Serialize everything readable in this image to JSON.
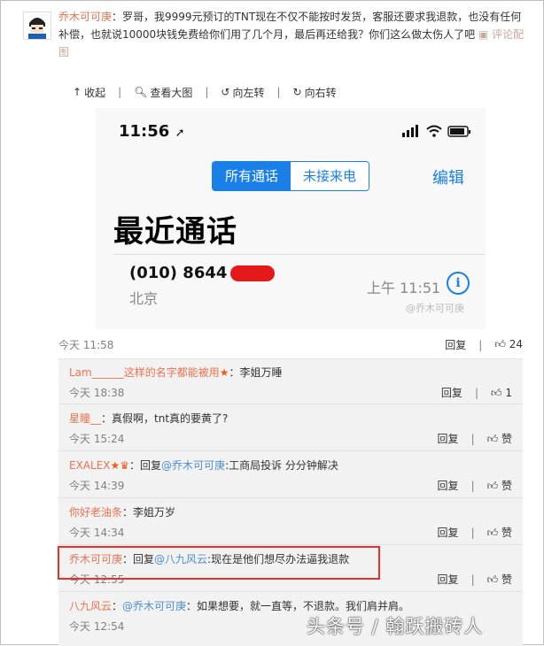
{
  "post": {
    "author": "乔木可可庚",
    "text": "：罗哥，我9999元预订的TNT现在不仅不能按时发货，客服还要求我退款，也没有任何补偿，也就说10000块钱免费给你们用了几个月，最后再还给我？你们这么做太伤人了吧",
    "action": "评论配图"
  },
  "toolbar": {
    "collapse": "收起",
    "view_large": "查看大图",
    "rotate_left": "向左转",
    "rotate_right": "向右转"
  },
  "screenshot": {
    "time": "11:56",
    "tab_all": "所有通话",
    "tab_missed": "未接来电",
    "edit": "编辑",
    "title": "最近通话",
    "number": "(010) 8644",
    "city": "北京",
    "call_time": "上午 11:51",
    "watermark": "@乔木可可庚"
  },
  "post_meta": {
    "time": "今天 11:58",
    "reply": "回复",
    "likes": "24"
  },
  "comments": [
    {
      "user": "Lam______这样的名字都能被用",
      "text": "：李姐万睡",
      "time": "今天 18:38",
      "reply": "回复",
      "like": "1"
    },
    {
      "user": "星瞳__",
      "text": "：真假啊，tnt真的要黄了?",
      "time": "今天 15:24",
      "reply": "回复",
      "like": "赞"
    },
    {
      "user": "EXALEX",
      "pre": "：回复",
      "mention": "@乔木可可庚",
      "text": ":工商局投诉 分分钟解决",
      "time": "今天 14:39",
      "reply": "回复",
      "like": "赞"
    },
    {
      "user": "你好老油条",
      "text": "：李姐万岁",
      "time": "今天 14:34",
      "reply": "回复",
      "like": "赞"
    },
    {
      "user": "乔木可可庚",
      "pre": "：回复",
      "mention": "@八九风云",
      "text": ":现在是他们想尽办法逼我退款",
      "time": "今天 12:55",
      "reply": "回复",
      "like": "赞"
    },
    {
      "user": "八九风云",
      "pre": "：",
      "mention": "@乔木可可庚",
      "text": "：如果想要，就一直等，不退款。我们肩并肩。",
      "time": "今天 12:54",
      "reply": "",
      "like": ""
    }
  ],
  "footer_watermark": "头条号 / 翰跃搬砖人",
  "colors": {
    "link": "#eb7350",
    "mention": "#4d8fce",
    "ios_blue": "#1a7fe6",
    "highlight": "#e5322b"
  }
}
